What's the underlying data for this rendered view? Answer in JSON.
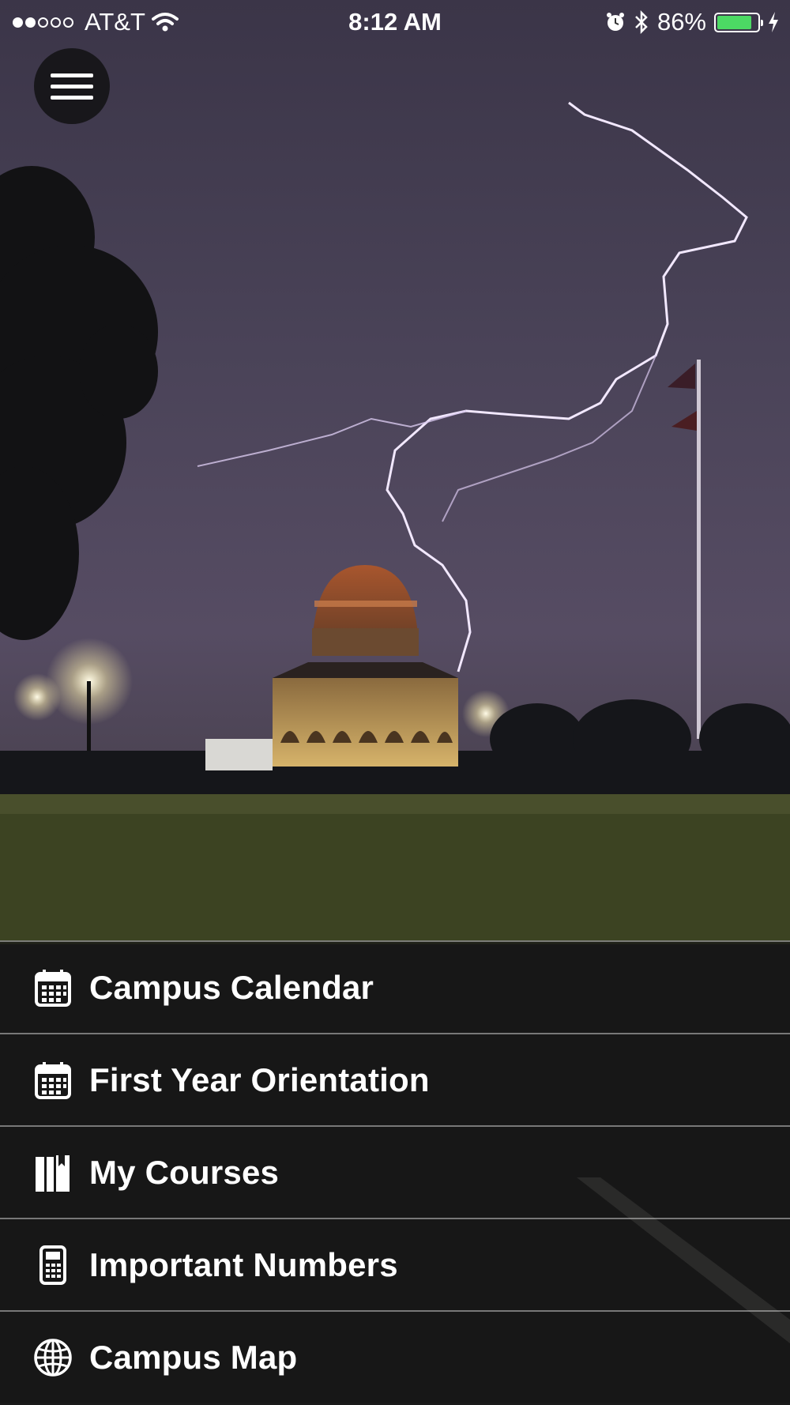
{
  "status_bar": {
    "carrier": "AT&T",
    "signal_dots_filled": 2,
    "signal_dots_total": 5,
    "time": "8:12 AM",
    "battery_percent_label": "86%",
    "battery_level": 0.86,
    "icons": [
      "wifi-icon",
      "alarm-icon",
      "bluetooth-icon",
      "battery-icon",
      "charging-bolt-icon"
    ]
  },
  "menu_button": {
    "icon": "hamburger-menu-icon"
  },
  "hero_image": {
    "subject": "domed building with lightning storm"
  },
  "nav": {
    "items": [
      {
        "label": "Campus Calendar",
        "icon": "calendar-icon"
      },
      {
        "label": "First Year Orientation",
        "icon": "calendar-icon"
      },
      {
        "label": "My Courses",
        "icon": "books-icon"
      },
      {
        "label": "Important Numbers",
        "icon": "phone-icon"
      },
      {
        "label": "Campus Map",
        "icon": "globe-icon"
      }
    ]
  },
  "colors": {
    "nav_background": "#161616",
    "divider": "#c8c8c8",
    "battery_fill": "#4cd964",
    "sky": "#4a4358"
  }
}
